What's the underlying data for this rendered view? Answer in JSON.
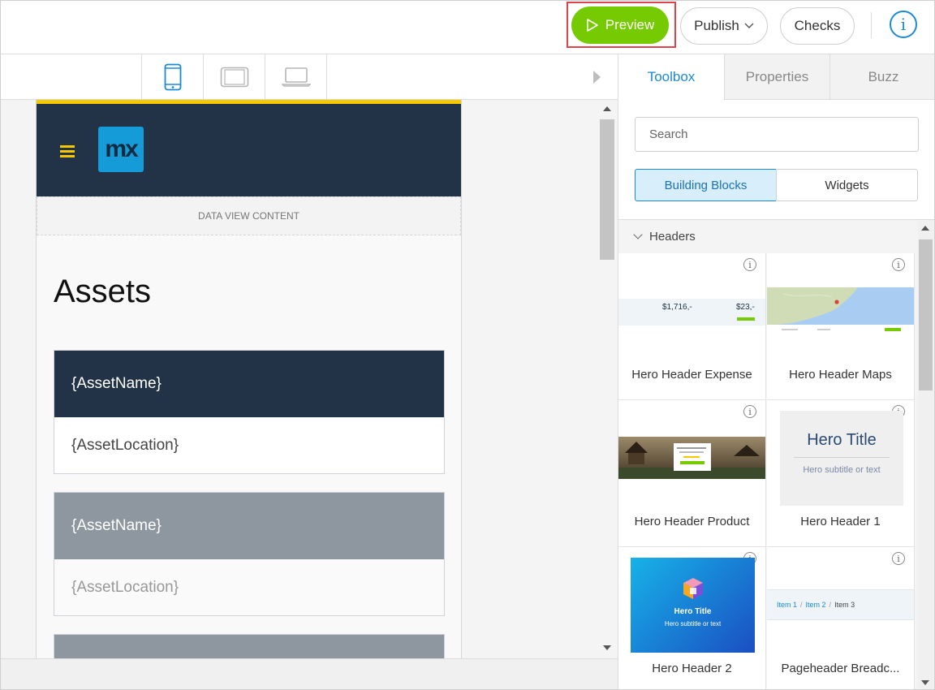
{
  "toolbar": {
    "preview_label": "Preview",
    "publish_label": "Publish",
    "checks_label": "Checks",
    "info_icon": "i"
  },
  "device_tabs": [
    "phone",
    "tablet",
    "desktop"
  ],
  "canvas": {
    "logo_text": "mx",
    "dataview_label": "DATA VIEW CONTENT",
    "page_title": "Assets",
    "cards": [
      {
        "name": "{AssetName}",
        "location": "{AssetLocation}"
      },
      {
        "name": "{AssetName}",
        "location": "{AssetLocation}"
      }
    ]
  },
  "panel": {
    "tabs": [
      "Toolbox",
      "Properties",
      "Buzz"
    ],
    "active_tab": "Toolbox",
    "search_placeholder": "Search",
    "segments": [
      "Building Blocks",
      "Widgets"
    ],
    "section_title": "Headers",
    "tiles": [
      {
        "label": "Hero Header Expense",
        "price_a": "$1,716,-",
        "price_b": "$23,-"
      },
      {
        "label": "Hero Header Maps"
      },
      {
        "label": "Hero Header Product"
      },
      {
        "label": "Hero Header 1",
        "hero_title": "Hero Title",
        "hero_subtitle": "Hero subtitle or text"
      },
      {
        "label": "Hero Header 2",
        "hero_title": "Hero Title",
        "hero_subtitle": "Hero subtitle or text"
      },
      {
        "label": "Pageheader Breadc...",
        "crumbs": [
          "Item 1",
          "Item 2",
          "Item 3"
        ]
      }
    ]
  },
  "colors": {
    "accent": "#1b8ad6",
    "preview_green": "#76ca02",
    "header_navy": "#223348",
    "brand_yellow": "#f5c800",
    "highlight_red": "#e0434b"
  }
}
